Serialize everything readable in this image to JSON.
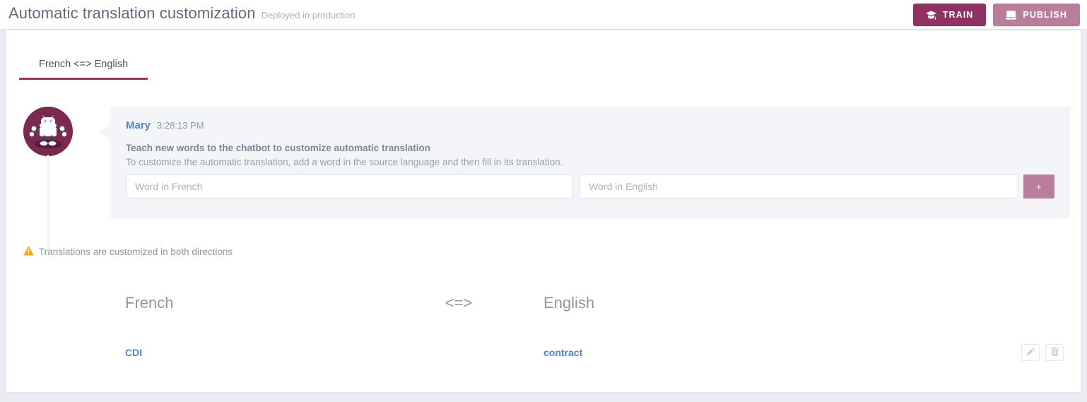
{
  "header": {
    "title": "Automatic translation customization",
    "subtitle": "Deployed in production",
    "train_label": "TRAIN",
    "publish_label": "PUBLISH",
    "train_icon": "graduation-cap-icon",
    "publish_icon": "book-icon",
    "train_color": "#8f3263",
    "publish_color": "#b97e9c"
  },
  "tabs": [
    {
      "label": "French <=> English",
      "active": true
    }
  ],
  "chat": {
    "avatar_icon": "robot-avatar-icon",
    "avatar_color": "#7a2a50",
    "sender": "Mary",
    "timestamp": "3:28:13 PM",
    "message_title": "Teach new words to the chatbot to customize automatic translation",
    "message_body": "To customize the automatic translation, add a word in the source language and then fill in its translation.",
    "source_placeholder": "Word in French",
    "source_value": "",
    "target_placeholder": "Word in English",
    "target_value": "",
    "add_label": "+"
  },
  "warning": {
    "icon": "warning-triangle-icon",
    "color": "#f5a623",
    "text": "Translations are customized in both directions"
  },
  "translations_table": {
    "columns": {
      "source": "French",
      "arrow": "<=>",
      "target": "English"
    },
    "rows": [
      {
        "source": "CDI",
        "target": "contract",
        "edit_icon": "pencil-icon",
        "delete_icon": "trash-icon"
      }
    ]
  }
}
